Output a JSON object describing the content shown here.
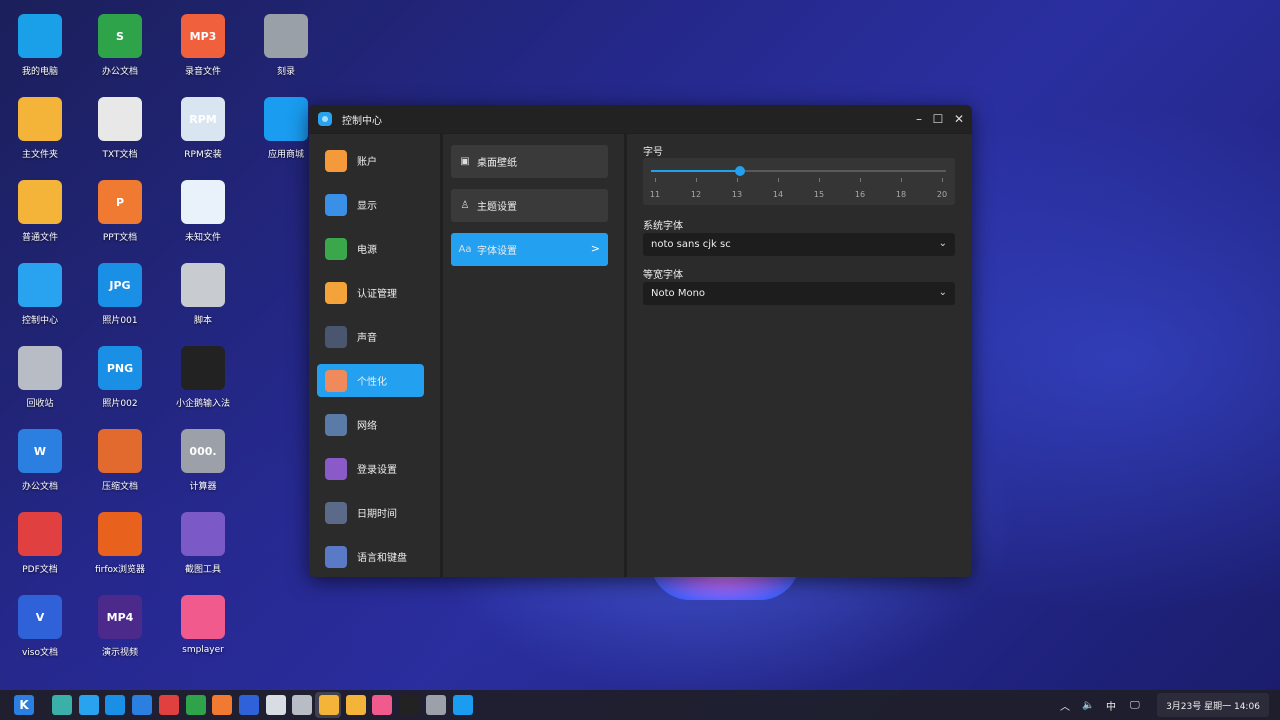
{
  "desktop": {
    "icons": [
      {
        "label": "我的电脑",
        "color": "#1aa0e8",
        "glyph": ""
      },
      {
        "label": "办公文档",
        "color": "#2fa34a",
        "glyph": "S"
      },
      {
        "label": "录音文件",
        "color": "#f0603c",
        "glyph": "MP3"
      },
      {
        "label": "刻录",
        "color": "#9aa0a8",
        "glyph": ""
      },
      {
        "label": "主文件夹",
        "color": "#f4b43a",
        "glyph": ""
      },
      {
        "label": "TXT文档",
        "color": "#e8e8e8",
        "glyph": ""
      },
      {
        "label": "RPM安装",
        "color": "#d9e6f2",
        "glyph": "RPM"
      },
      {
        "label": "应用商城",
        "color": "#1a9cf0",
        "glyph": ""
      },
      {
        "label": "普通文件",
        "color": "#f4b43a",
        "glyph": ""
      },
      {
        "label": "PPT文档",
        "color": "#f07a32",
        "glyph": "P"
      },
      {
        "label": "未知文件",
        "color": "#e9f1fb",
        "glyph": ""
      },
      {
        "label": "控制中心",
        "color": "#29a3ef",
        "glyph": ""
      },
      {
        "label": "照片001",
        "color": "#1a8fe6",
        "glyph": "JPG"
      },
      {
        "label": "脚本",
        "color": "#c8cbd0",
        "glyph": ""
      },
      {
        "label": "回收站",
        "color": "#b8bcc4",
        "glyph": ""
      },
      {
        "label": "照片002",
        "color": "#1a8fe6",
        "glyph": "PNG"
      },
      {
        "label": "小企鹅输入法",
        "color": "#222",
        "glyph": ""
      },
      {
        "label": "办公文档",
        "color": "#2b7fe0",
        "glyph": "W"
      },
      {
        "label": "压缩文档",
        "color": "#e36a2e",
        "glyph": ""
      },
      {
        "label": "计算器",
        "color": "#9ca0a8",
        "glyph": "000."
      },
      {
        "label": "PDF文档",
        "color": "#e04040",
        "glyph": ""
      },
      {
        "label": "firfox浏览器",
        "color": "#e8611d",
        "glyph": ""
      },
      {
        "label": "截图工具",
        "color": "#7b5ac8",
        "glyph": ""
      },
      {
        "label": "viso文档",
        "color": "#2f62d8",
        "glyph": "V"
      },
      {
        "label": "演示视频",
        "color": "#4c2a8c",
        "glyph": "MP4"
      },
      {
        "label": "smplayer",
        "color": "#f05a8c",
        "glyph": ""
      }
    ]
  },
  "window": {
    "title": "控制中心",
    "minimize": "–",
    "maximize": "☐",
    "close": "✕",
    "nav": [
      {
        "label": "账户",
        "color": "#f49a3a"
      },
      {
        "label": "显示",
        "color": "#3a8fe6"
      },
      {
        "label": "电源",
        "color": "#3aa84a"
      },
      {
        "label": "认证管理",
        "color": "#f4a23a"
      },
      {
        "label": "声音",
        "color": "#4a5570"
      },
      {
        "label": "个性化",
        "color": "#f08a5a"
      },
      {
        "label": "网络",
        "color": "#5a7aa8"
      },
      {
        "label": "登录设置",
        "color": "#8a5ac8"
      },
      {
        "label": "日期时间",
        "color": "#5a6a88"
      },
      {
        "label": "语言和键盘",
        "color": "#5a7ac8"
      }
    ],
    "sub": [
      {
        "label": "桌面壁纸",
        "icon": "▣"
      },
      {
        "label": "主题设置",
        "icon": "♙"
      },
      {
        "label": "字体设置",
        "icon": "Aa",
        "chevron": ">"
      }
    ],
    "font_settings": {
      "size_label": "字号",
      "ticks": [
        "11",
        "12",
        "13",
        "14",
        "15",
        "16",
        "17",
        "18",
        "19",
        "20"
      ],
      "tick_labels": [
        "11",
        "12",
        "13",
        "14",
        "15",
        "16",
        "18",
        "20"
      ],
      "value": 14,
      "min": 11,
      "max": 20,
      "system_font_label": "系统字体",
      "system_font_value": "noto sans cjk sc",
      "mono_font_label": "等宽字体",
      "mono_font_value": "Noto Mono",
      "caret": "⌄"
    }
  },
  "taskbar": {
    "start_label": "K",
    "apps": [
      {
        "color": "#3ab0a8"
      },
      {
        "color": "#29a3ef"
      },
      {
        "color": "#1a8fe6"
      },
      {
        "color": "#2b7fe0"
      },
      {
        "color": "#e04040"
      },
      {
        "color": "#2fa34a"
      },
      {
        "color": "#f07a32"
      },
      {
        "color": "#2f62d8"
      },
      {
        "color": "#d8dde4"
      },
      {
        "color": "#b8bcc4"
      },
      {
        "color": "#f4b43a"
      },
      {
        "color": "#f4b43a"
      },
      {
        "color": "#f05a8c"
      },
      {
        "color": "#222"
      },
      {
        "color": "#9ca0a8"
      },
      {
        "color": "#1a9cf0"
      }
    ],
    "tray_arrow": "︿",
    "volume": "🔈",
    "ime": "中",
    "monitor": "🖵",
    "clock": "3月23号 星期一 14:06"
  }
}
